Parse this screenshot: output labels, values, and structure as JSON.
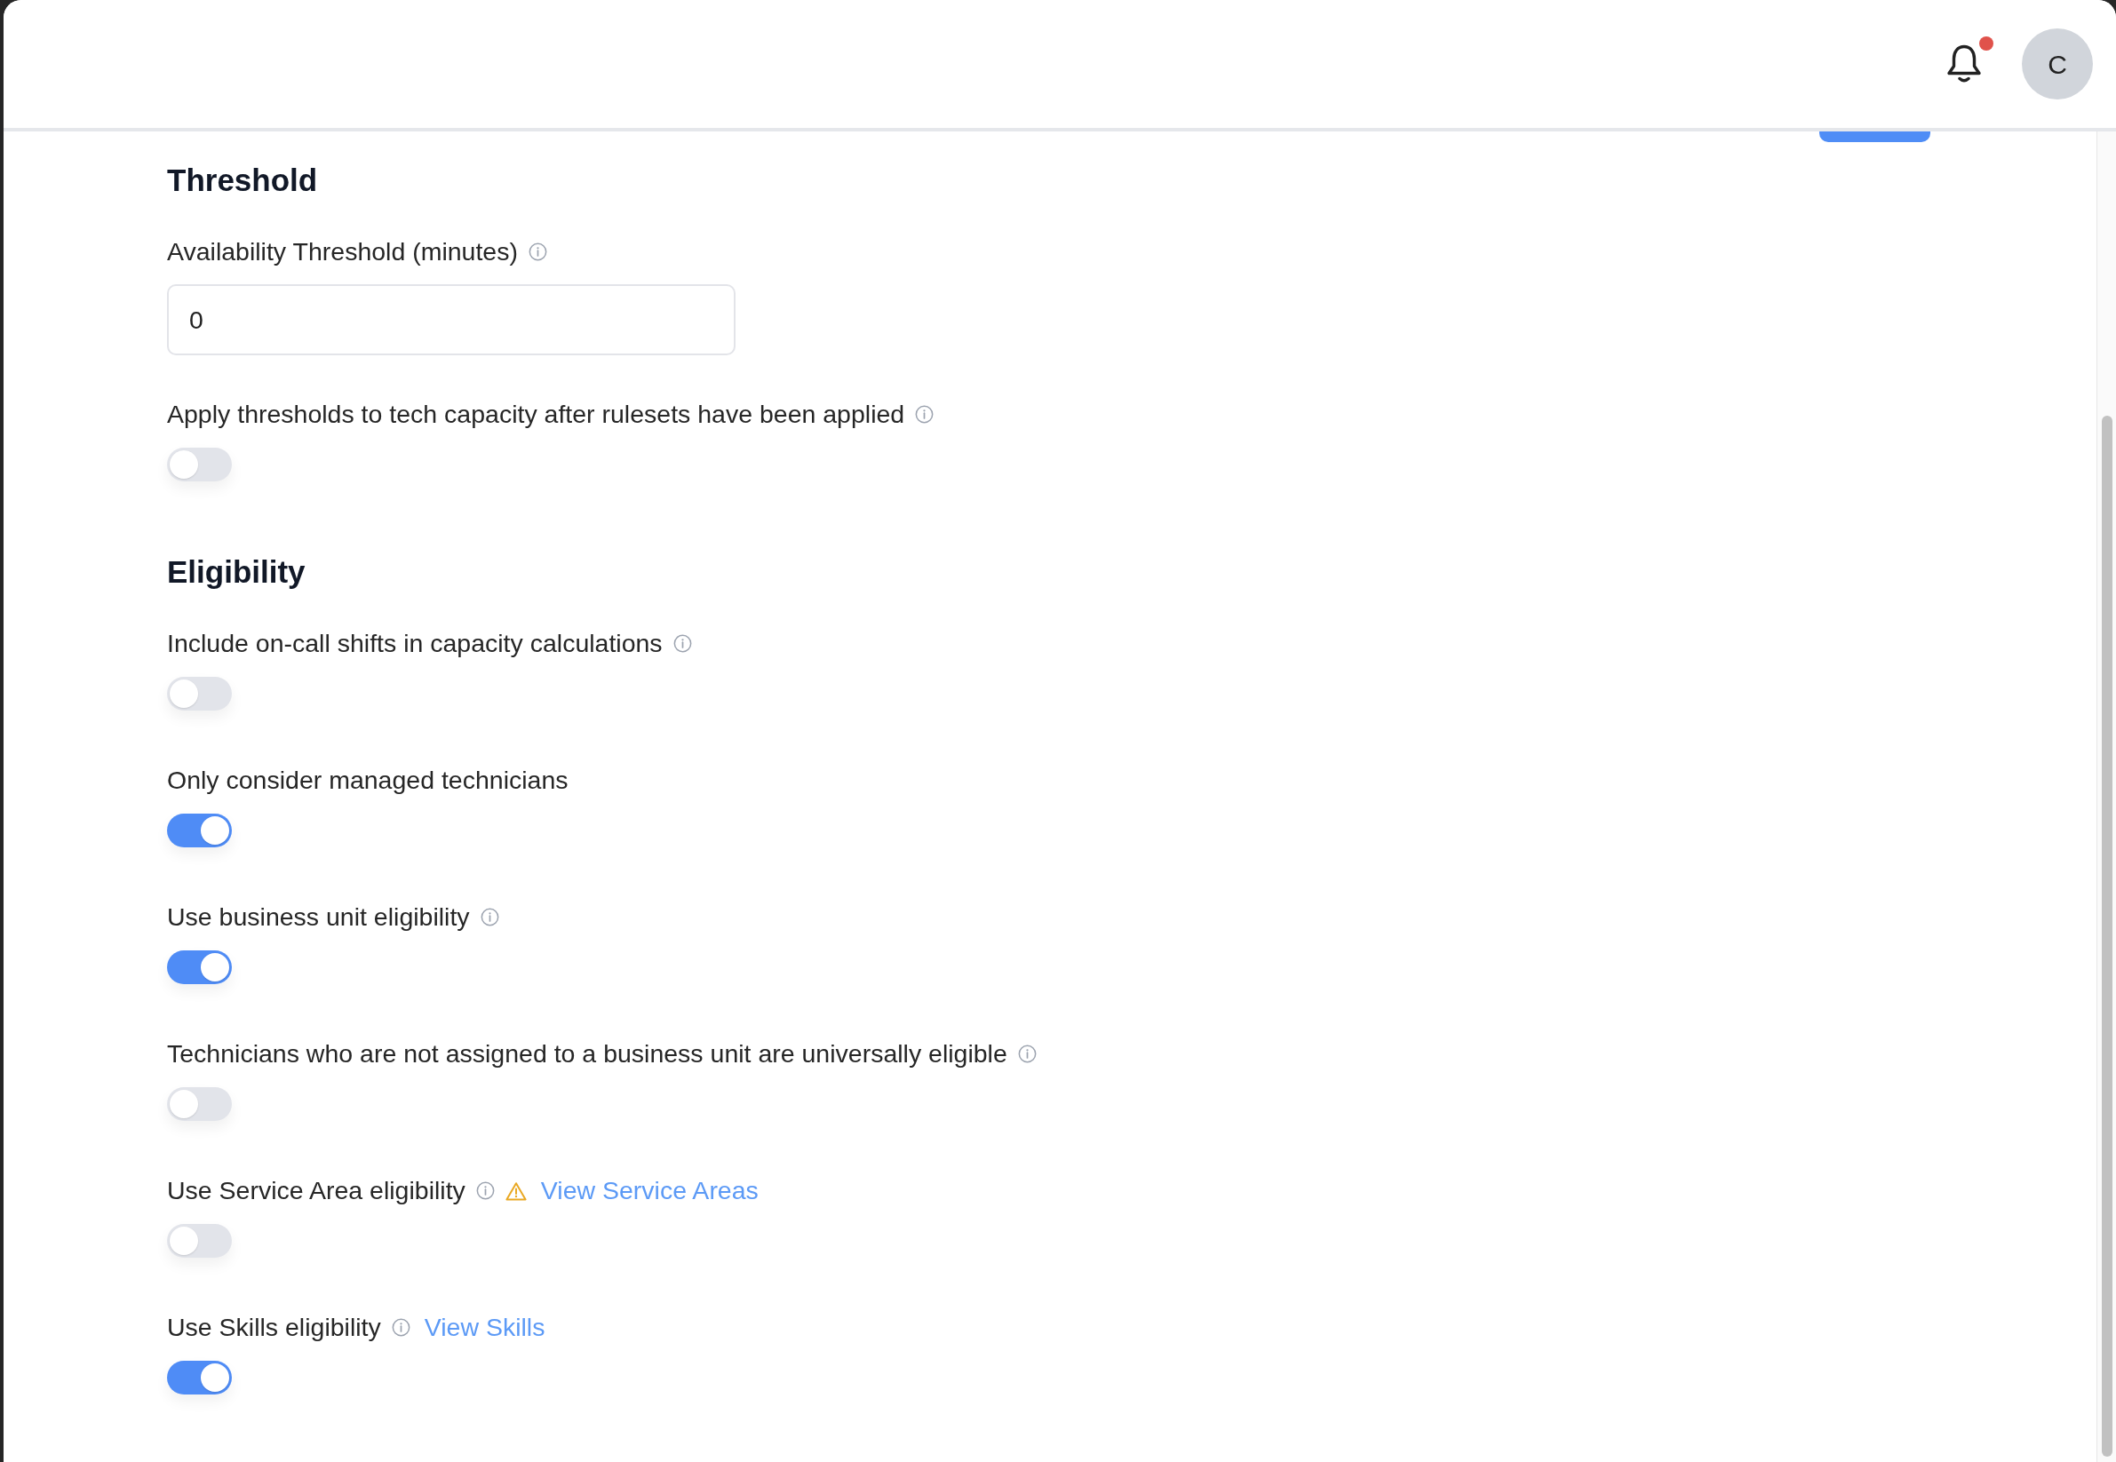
{
  "header": {
    "notifications": {
      "unread": true
    },
    "avatar": {
      "initial": "C"
    }
  },
  "sections": [
    {
      "title": "Threshold",
      "fields": [
        {
          "kind": "number",
          "label": "Availability Threshold (minutes)",
          "info": true,
          "value": "0"
        },
        {
          "kind": "toggle",
          "label": "Apply thresholds to tech capacity after rulesets have been applied",
          "info": true,
          "on": false
        }
      ]
    },
    {
      "title": "Eligibility",
      "fields": [
        {
          "kind": "toggle",
          "label": "Include on-call shifts in capacity calculations",
          "info": true,
          "on": false
        },
        {
          "kind": "toggle",
          "label": "Only consider managed technicians",
          "info": false,
          "on": true
        },
        {
          "kind": "toggle",
          "label": "Use business unit eligibility",
          "info": true,
          "on": true
        },
        {
          "kind": "toggle",
          "label": "Technicians who are not assigned to a business unit are universally eligible",
          "info": true,
          "on": false
        },
        {
          "kind": "toggle",
          "label": "Use Service Area eligibility",
          "info": true,
          "warning": true,
          "link": "View Service Areas",
          "on": false
        },
        {
          "kind": "toggle",
          "label": "Use Skills eligibility",
          "info": true,
          "link": "View Skills",
          "on": true
        }
      ]
    }
  ]
}
